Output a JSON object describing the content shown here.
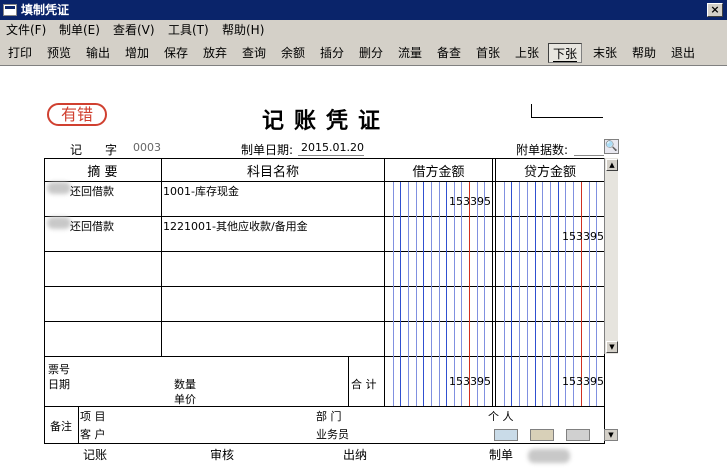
{
  "window": {
    "title": "填制凭证",
    "close": "×"
  },
  "menu": [
    "文件(F)",
    "制单(E)",
    "查看(V)",
    "工具(T)",
    "帮助(H)"
  ],
  "toolbar": [
    "打印",
    "预览",
    "输出",
    "增加",
    "保存",
    "放弃",
    "查询",
    "余额",
    "插分",
    "删分",
    "流量",
    "备查",
    "首张",
    "上张",
    "下张",
    "末张",
    "帮助",
    "退出"
  ],
  "voucher": {
    "status_stamp": "有错",
    "title": "记账凭证",
    "type_label": "记",
    "zi_label": "字",
    "number": "0003",
    "date_label": "制单日期:",
    "date": "2015.01.20",
    "attachments_label": "附单据数:",
    "headers": {
      "summary": "摘 要",
      "account": "科目名称",
      "debit": "借方金额",
      "credit": "贷方金额"
    },
    "rows": [
      {
        "summary": "还回借款",
        "account": "1001-库存现金",
        "debit": "153395",
        "credit": ""
      },
      {
        "summary": "还回借款",
        "account": "1221001-其他应收款/备用金",
        "debit": "",
        "credit": "153395"
      }
    ],
    "footer": {
      "ticket_no": "票号",
      "date": "日期",
      "quantity": "数量",
      "unit_price": "单价",
      "total_label": "合 计",
      "total_debit": "153395",
      "total_credit": "153395",
      "remarks": "备注",
      "project": "项 目",
      "customer": "客 户",
      "department": "部 门",
      "salesperson": "业务员",
      "person": "个 人"
    },
    "signatures": {
      "bookkeeping": "记账",
      "review": "审核",
      "cashier": "出纳",
      "preparer": "制单"
    }
  }
}
